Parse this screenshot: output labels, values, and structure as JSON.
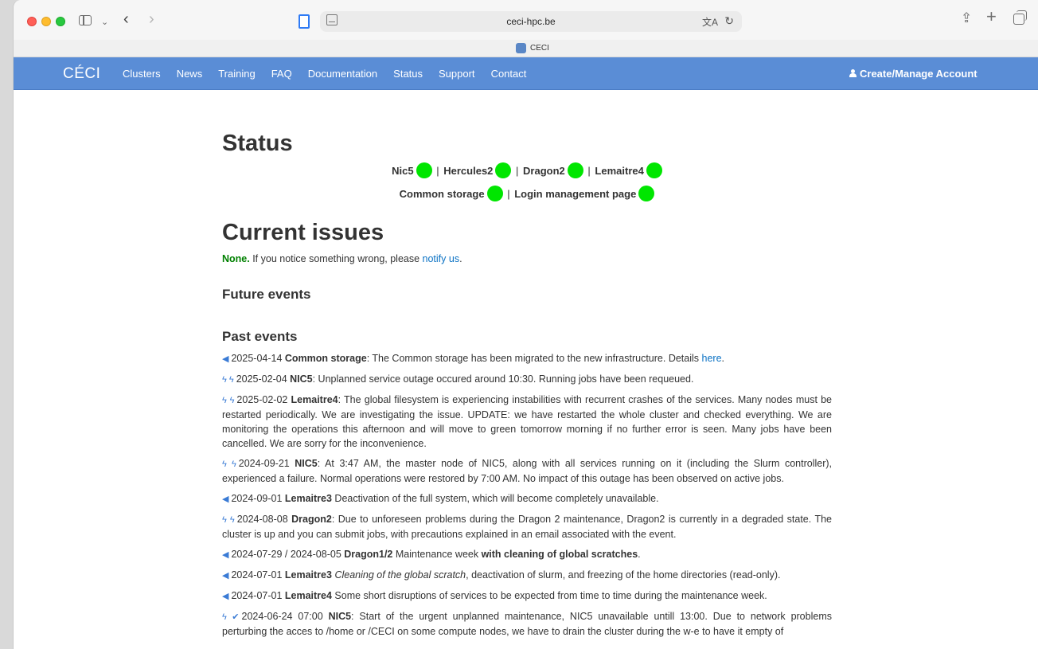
{
  "browser": {
    "url": "ceci-hpc.be",
    "tab_title": "CECI"
  },
  "nav": {
    "brand": "CÉCI",
    "links": [
      "Clusters",
      "News",
      "Training",
      "FAQ",
      "Documentation",
      "Status",
      "Support",
      "Contact"
    ],
    "account": "Create/Manage Account"
  },
  "status": {
    "title": "Status",
    "row1": [
      "Nic5",
      "Hercules2",
      "Dragon2",
      "Lemaitre4"
    ],
    "row2": [
      "Common storage",
      "Login management page"
    ],
    "indicator_color": "#00e600"
  },
  "issues": {
    "title": "Current issues",
    "none_label": "None.",
    "text_before": " If you notice something wrong, please ",
    "link": "notify us",
    "text_after": "."
  },
  "future": {
    "title": "Future events"
  },
  "past": {
    "title": "Past events",
    "events": [
      {
        "icon": "megaphone-icon",
        "date": "2025-04-14",
        "name": "Common storage",
        "text": ": The Common storage has been migrated to the new infrastructure. Details ",
        "link": "here",
        "after": "."
      },
      {
        "icon": "lightning-icon",
        "date": "2025-02-04",
        "name": "NIC5",
        "text": ": Unplanned service outage occured around 10:30. Running jobs have been requeued."
      },
      {
        "icon": "lightning-icon",
        "date": "2025-02-02",
        "name": "Lemaitre4",
        "text": ": The global filesystem is experiencing instabilities with recurrent crashes of the services. Many nodes must be restarted periodically. We are investigating the issue. UPDATE: we have restarted the whole cluster and checked everything. We are monitoring the operations this afternoon and will move to green tomorrow morning if no further error is seen. Many jobs have been cancelled. We are sorry for the inconvenience."
      },
      {
        "icon": "lightning-icon",
        "date": "2024-09-21",
        "name": "NIC5",
        "text": ": At 3:47 AM, the master node of NIC5, along with all services running on it (including the Slurm controller), experienced a failure. Normal operations were restored by 7:00 AM. No impact of this outage has been observed on active jobs."
      },
      {
        "icon": "megaphone-icon",
        "date": "2024-09-01",
        "name": "Lemaitre3",
        "text": " Deactivation of the full system, which will become completely unavailable."
      },
      {
        "icon": "lightning-icon",
        "date": "2024-08-08",
        "name": "Dragon2",
        "text": ": Due to unforeseen problems during the Dragon 2 maintenance, Dragon2 is currently in a degraded state. The cluster is up and you can submit jobs, with precautions explained in an email associated with the event."
      },
      {
        "icon": "megaphone-icon",
        "date": "2024-07-29 / 2024-08-05",
        "name": "Dragon1/2",
        "text": " Maintenance week ",
        "bold_tail": "with cleaning of global scratches",
        "after": "."
      },
      {
        "icon": "megaphone-icon",
        "date": "2024-07-01",
        "name": "Lemaitre3",
        "italic": "Cleaning of the global scratch",
        "text": ", deactivation of slurm, and freezing of the home directories (read-only)."
      },
      {
        "icon": "megaphone-icon",
        "date": "2024-07-01",
        "name": "Lemaitre4",
        "text": " Some short disruptions of services to be expected from time to time during the maintenance week."
      },
      {
        "icon": "lightning-check-icon",
        "date": "2024-06-24 07:00",
        "name": "NIC5",
        "text": ": Start of the urgent unplanned maintenance, NIC5 unavailable untill 13:00. Due to network problems perturbing the acces to /home or /CECI on some compute nodes, we have to drain the cluster during the w-e to have it empty of"
      }
    ]
  }
}
